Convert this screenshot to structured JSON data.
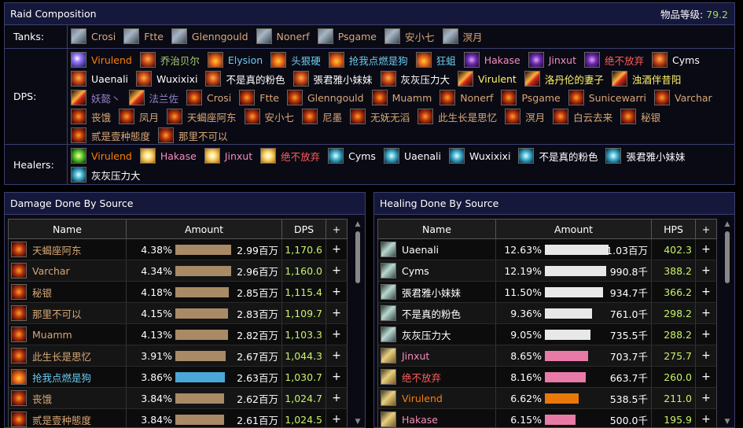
{
  "raid": {
    "title": "Raid Composition",
    "ilvl_label": "物品等级:",
    "ilvl_value": "79.2",
    "tanks_label": "Tanks:",
    "dps_label": "DPS:",
    "healers_label": "Healers:",
    "tanks": [
      {
        "name": "Crosi",
        "color": "c-tan",
        "icon": "shield"
      },
      {
        "name": "Ftte",
        "color": "c-tan",
        "icon": "shield"
      },
      {
        "name": "Glenngould",
        "color": "c-tan",
        "icon": "shield"
      },
      {
        "name": "Nonerf",
        "color": "c-tan",
        "icon": "shield"
      },
      {
        "name": "Psgame",
        "color": "c-tan",
        "icon": "shield"
      },
      {
        "name": "安小七",
        "color": "c-tan",
        "icon": "shield"
      },
      {
        "name": "溟月",
        "color": "c-tan",
        "icon": "shield"
      }
    ],
    "dps": [
      {
        "name": "Virulend",
        "color": "c-orange",
        "icon": "arcane"
      },
      {
        "name": "乔治贝尔",
        "color": "c-green",
        "icon": "face"
      },
      {
        "name": "Elysion",
        "color": "c-blue",
        "icon": "fire"
      },
      {
        "name": "头狠硬",
        "color": "c-blue",
        "icon": "fire"
      },
      {
        "name": "抢我点燃是狗",
        "color": "c-blue",
        "icon": "fire"
      },
      {
        "name": "狂蛆",
        "color": "c-blue",
        "icon": "fire"
      },
      {
        "name": "Hakase",
        "color": "c-pink",
        "icon": "demon"
      },
      {
        "name": "Jinxut",
        "color": "c-pink",
        "icon": "demon"
      },
      {
        "name": "绝不放弃",
        "color": "c-red",
        "icon": "demon"
      },
      {
        "name": "Cyms",
        "color": "c-white",
        "icon": "face"
      },
      {
        "name": "Uaenali",
        "color": "c-white",
        "icon": "face"
      },
      {
        "name": "Wuxixixi",
        "color": "c-white",
        "icon": "face"
      },
      {
        "name": "不是真的粉色",
        "color": "c-white",
        "icon": "face"
      },
      {
        "name": "張君雅小妹妹",
        "color": "c-white",
        "icon": "face"
      },
      {
        "name": "灰灰压力大",
        "color": "c-white",
        "icon": "face"
      },
      {
        "name": "Virulent",
        "color": "c-yellow",
        "icon": "sword"
      },
      {
        "name": "洛丹伦的妻子",
        "color": "c-yellow",
        "icon": "sword"
      },
      {
        "name": "浊酒伴昔阳",
        "color": "c-yellow",
        "icon": "sword"
      },
      {
        "name": "妖懿丶",
        "color": "c-purple",
        "icon": "sword"
      },
      {
        "name": "法兰佐",
        "color": "c-purple",
        "icon": "sword"
      },
      {
        "name": "Crosi",
        "color": "c-tan",
        "icon": "warrior"
      },
      {
        "name": "Ftte",
        "color": "c-tan",
        "icon": "warrior"
      },
      {
        "name": "Glenngould",
        "color": "c-tan",
        "icon": "warrior"
      },
      {
        "name": "Muamm",
        "color": "c-tan",
        "icon": "warrior"
      },
      {
        "name": "Nonerf",
        "color": "c-tan",
        "icon": "warrior"
      },
      {
        "name": "Psgame",
        "color": "c-tan",
        "icon": "warrior"
      },
      {
        "name": "Sunicewarri",
        "color": "c-tan",
        "icon": "warrior"
      },
      {
        "name": "Varchar",
        "color": "c-tan",
        "icon": "warrior"
      },
      {
        "name": "丧饿",
        "color": "c-tan",
        "icon": "warrior"
      },
      {
        "name": "凤月",
        "color": "c-tan",
        "icon": "warrior"
      },
      {
        "name": "天蝎座阿东",
        "color": "c-tan",
        "icon": "warrior"
      },
      {
        "name": "安小七",
        "color": "c-tan",
        "icon": "warrior"
      },
      {
        "name": "尼墨",
        "color": "c-tan",
        "icon": "warrior"
      },
      {
        "name": "无妩无滔",
        "color": "c-tan",
        "icon": "warrior"
      },
      {
        "name": "此生长是思忆",
        "color": "c-tan",
        "icon": "warrior"
      },
      {
        "name": "溟月",
        "color": "c-tan",
        "icon": "warrior"
      },
      {
        "name": "白云去来",
        "color": "c-tan",
        "icon": "warrior"
      },
      {
        "name": "秘银",
        "color": "c-tan",
        "icon": "warrior"
      },
      {
        "name": "贰是壹种態度",
        "color": "c-tan",
        "icon": "warrior"
      },
      {
        "name": "那里不可以",
        "color": "c-tan",
        "icon": "warrior"
      }
    ],
    "healers": [
      {
        "name": "Virulend",
        "color": "c-orange",
        "icon": "druid"
      },
      {
        "name": "Hakase",
        "color": "c-pink",
        "icon": "holy"
      },
      {
        "name": "Jinxut",
        "color": "c-pink",
        "icon": "holy"
      },
      {
        "name": "绝不放弃",
        "color": "c-red",
        "icon": "holy"
      },
      {
        "name": "Cyms",
        "color": "c-white",
        "icon": "mana"
      },
      {
        "name": "Uaenali",
        "color": "c-white",
        "icon": "mana"
      },
      {
        "name": "Wuxixixi",
        "color": "c-white",
        "icon": "mana"
      },
      {
        "name": "不是真的粉色",
        "color": "c-white",
        "icon": "mana"
      },
      {
        "name": "張君雅小妹妹",
        "color": "c-white",
        "icon": "mana"
      },
      {
        "name": "灰灰压力大",
        "color": "c-white",
        "icon": "mana"
      }
    ]
  },
  "damage": {
    "title": "Damage Done By Source",
    "headers": {
      "name": "Name",
      "amount": "Amount",
      "rate": "DPS",
      "plus": "+"
    },
    "rows": [
      {
        "name": "天蝎座阿东",
        "color": "c-tan",
        "icon": "warrior",
        "pct": "4.38%",
        "fill": 0.85,
        "bar": "#a88a66",
        "amount": "2.99百万",
        "rate": "1,170.6"
      },
      {
        "name": "Varchar",
        "color": "c-tan",
        "icon": "warrior",
        "pct": "4.34%",
        "fill": 0.84,
        "bar": "#a88a66",
        "amount": "2.96百万",
        "rate": "1,160.0"
      },
      {
        "name": "秘银",
        "color": "c-tan",
        "icon": "warrior",
        "pct": "4.18%",
        "fill": 0.81,
        "bar": "#a88a66",
        "amount": "2.85百万",
        "rate": "1,115.4"
      },
      {
        "name": "那里不可以",
        "color": "c-tan",
        "icon": "warrior",
        "pct": "4.15%",
        "fill": 0.8,
        "bar": "#a88a66",
        "amount": "2.83百万",
        "rate": "1,109.7"
      },
      {
        "name": "Muamm",
        "color": "c-tan",
        "icon": "warrior",
        "pct": "4.13%",
        "fill": 0.8,
        "bar": "#a88a66",
        "amount": "2.82百万",
        "rate": "1,103.3"
      },
      {
        "name": "此生长是思忆",
        "color": "c-tan",
        "icon": "warrior",
        "pct": "3.91%",
        "fill": 0.76,
        "bar": "#a88a66",
        "amount": "2.67百万",
        "rate": "1,044.3"
      },
      {
        "name": "抢我点燃是狗",
        "color": "c-blue",
        "icon": "fire",
        "pct": "3.86%",
        "fill": 0.75,
        "bar": "#4aa8d8",
        "amount": "2.63百万",
        "rate": "1,030.7"
      },
      {
        "name": "丧饿",
        "color": "c-tan",
        "icon": "warrior",
        "pct": "3.84%",
        "fill": 0.74,
        "bar": "#a88a66",
        "amount": "2.62百万",
        "rate": "1,024.7"
      },
      {
        "name": "贰是壹种態度",
        "color": "c-tan",
        "icon": "warrior",
        "pct": "3.84%",
        "fill": 0.74,
        "bar": "#a88a66",
        "amount": "2.61百万",
        "rate": "1,024.5"
      }
    ]
  },
  "healing": {
    "title": "Healing Done By Source",
    "headers": {
      "name": "Name",
      "amount": "Amount",
      "rate": "HPS",
      "plus": "+"
    },
    "rows": [
      {
        "name": "Uaenali",
        "color": "c-white",
        "icon": "priest",
        "pct": "12.63%",
        "fill": 0.97,
        "bar": "#e8e8e8",
        "amount": "1.03百万",
        "rate": "402.3"
      },
      {
        "name": "Cyms",
        "color": "c-white",
        "icon": "priest",
        "pct": "12.19%",
        "fill": 0.93,
        "bar": "#e8e8e8",
        "amount": "990.8千",
        "rate": "388.2"
      },
      {
        "name": "張君雅小妹妹",
        "color": "c-white",
        "icon": "priest",
        "pct": "11.50%",
        "fill": 0.88,
        "bar": "#e8e8e8",
        "amount": "934.7千",
        "rate": "366.2"
      },
      {
        "name": "不是真的粉色",
        "color": "c-white",
        "icon": "priest",
        "pct": "9.36%",
        "fill": 0.72,
        "bar": "#e8e8e8",
        "amount": "761.0千",
        "rate": "298.2"
      },
      {
        "name": "灰灰压力大",
        "color": "c-white",
        "icon": "priest",
        "pct": "9.05%",
        "fill": 0.69,
        "bar": "#e8e8e8",
        "amount": "735.5千",
        "rate": "288.2"
      },
      {
        "name": "Jinxut",
        "color": "c-pink",
        "icon": "paladin",
        "pct": "8.65%",
        "fill": 0.66,
        "bar": "#e87aa8",
        "amount": "703.7千",
        "rate": "275.7"
      },
      {
        "name": "绝不放弃",
        "color": "c-red",
        "icon": "paladin",
        "pct": "8.16%",
        "fill": 0.62,
        "bar": "#e87aa8",
        "amount": "663.7千",
        "rate": "260.0"
      },
      {
        "name": "Virulend",
        "color": "c-orange",
        "icon": "paladin",
        "pct": "6.62%",
        "fill": 0.51,
        "bar": "#e8780a",
        "amount": "538.5千",
        "rate": "211.0"
      },
      {
        "name": "Hakase",
        "color": "c-pink",
        "icon": "paladin",
        "pct": "6.15%",
        "fill": 0.47,
        "bar": "#e87aa8",
        "amount": "500.0千",
        "rate": "195.9"
      }
    ]
  },
  "scroll": {
    "up": "▲",
    "down": "▼"
  }
}
